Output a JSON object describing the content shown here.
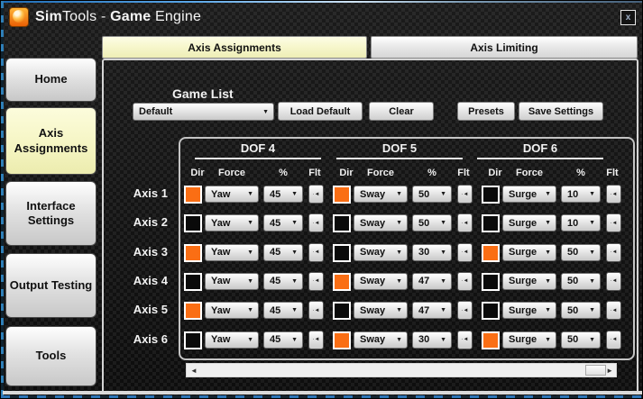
{
  "window": {
    "title_parts": [
      "Sim",
      "Tools - ",
      "Game",
      " Engine"
    ],
    "close_glyph": "x"
  },
  "tabs": [
    {
      "label": "Axis Assignments",
      "active": true
    },
    {
      "label": "Axis Limiting",
      "active": false
    }
  ],
  "sidebar": {
    "items": [
      {
        "label": "Home",
        "active": false
      },
      {
        "label": "Axis Assignments",
        "active": true
      },
      {
        "label": "Interface Settings",
        "active": false
      },
      {
        "label": "Output Testing",
        "active": false
      },
      {
        "label": "Tools",
        "active": false
      }
    ]
  },
  "game_list": {
    "label": "Game List",
    "selected": "Default",
    "buttons": [
      "Load Default",
      "Clear",
      "Presets",
      "Save Settings"
    ]
  },
  "table": {
    "dof_headers": [
      "DOF 4",
      "DOF 5",
      "DOF 6"
    ],
    "sub_headers": [
      "Dir",
      "Force",
      "%",
      "Flt"
    ],
    "rows": [
      {
        "label": "Axis 1",
        "cells": [
          {
            "dir": true,
            "force": "Yaw",
            "pct": "45"
          },
          {
            "dir": true,
            "force": "Sway",
            "pct": "50"
          },
          {
            "dir": false,
            "force": "Surge",
            "pct": "10"
          }
        ]
      },
      {
        "label": "Axis 2",
        "cells": [
          {
            "dir": false,
            "force": "Yaw",
            "pct": "45"
          },
          {
            "dir": false,
            "force": "Sway",
            "pct": "50"
          },
          {
            "dir": false,
            "force": "Surge",
            "pct": "10"
          }
        ]
      },
      {
        "label": "Axis 3",
        "cells": [
          {
            "dir": true,
            "force": "Yaw",
            "pct": "45"
          },
          {
            "dir": false,
            "force": "Sway",
            "pct": "30"
          },
          {
            "dir": true,
            "force": "Surge",
            "pct": "50"
          }
        ]
      },
      {
        "label": "Axis 4",
        "cells": [
          {
            "dir": false,
            "force": "Yaw",
            "pct": "45"
          },
          {
            "dir": true,
            "force": "Sway",
            "pct": "47"
          },
          {
            "dir": false,
            "force": "Surge",
            "pct": "50"
          }
        ]
      },
      {
        "label": "Axis 5",
        "cells": [
          {
            "dir": true,
            "force": "Yaw",
            "pct": "45"
          },
          {
            "dir": false,
            "force": "Sway",
            "pct": "47"
          },
          {
            "dir": false,
            "force": "Surge",
            "pct": "50"
          }
        ]
      },
      {
        "label": "Axis 6",
        "cells": [
          {
            "dir": false,
            "force": "Yaw",
            "pct": "45"
          },
          {
            "dir": true,
            "force": "Sway",
            "pct": "30"
          },
          {
            "dir": true,
            "force": "Surge",
            "pct": "50"
          }
        ]
      }
    ]
  },
  "icons": {
    "dropdown_arrow": "▼",
    "flt_glyph": "·◄",
    "scroll_left_arrow": "◄",
    "scroll_right_arrow": "►"
  },
  "colors": {
    "accent_orange": "#fa6e14",
    "active_yellow": "#f7f7cd",
    "title_accent_blue": "#3b87c8"
  }
}
